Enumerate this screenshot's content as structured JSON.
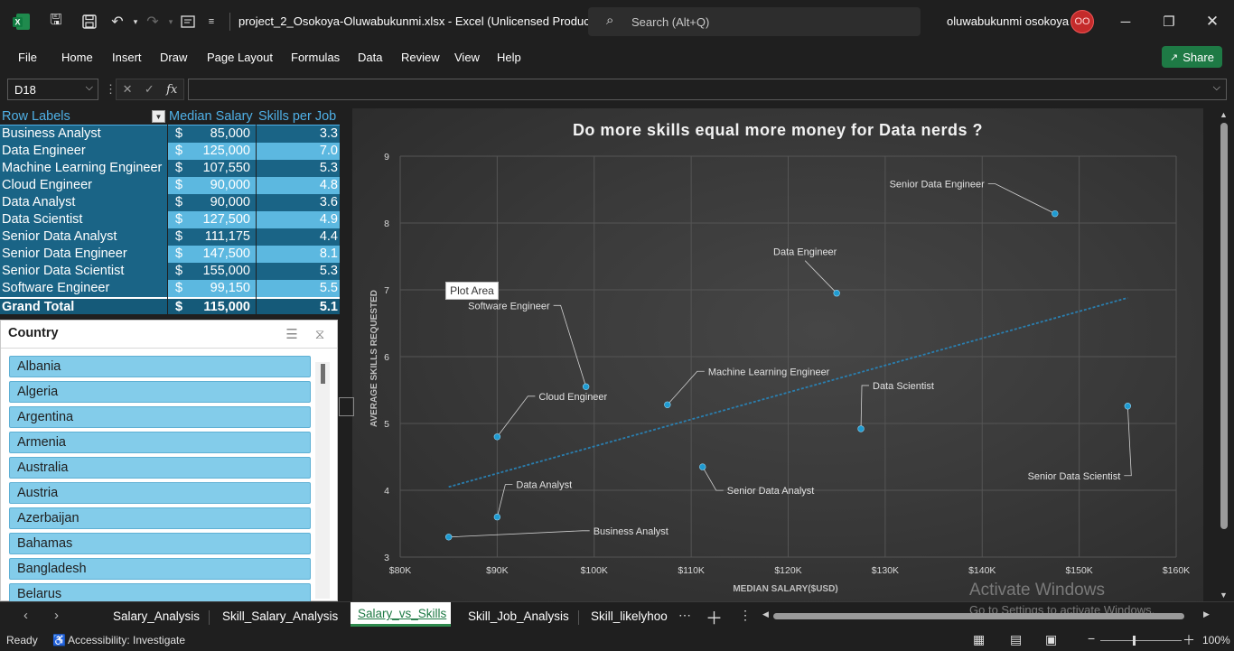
{
  "titlebar": {
    "doc_title": "project_2_Osokoya-Oluwabukunmi.xlsx  -  Excel (Unlicensed Product)",
    "search_placeholder": "Search (Alt+Q)",
    "user_name": "oluwabukunmi osokoya",
    "avatar_initials": "OO"
  },
  "menu": {
    "items": [
      "File",
      "Home",
      "Insert",
      "Draw",
      "Page Layout",
      "Formulas",
      "Data",
      "Review",
      "View",
      "Help"
    ],
    "share_label": "Share"
  },
  "formula_bar": {
    "name_box": "D18",
    "fx_label": "fx",
    "formula": ""
  },
  "pivot": {
    "headers": [
      "Row Labels",
      "Median Salary",
      "Skills per Job"
    ],
    "rows": [
      {
        "label": "Business Analyst",
        "salary": "85,000",
        "skills": "3.3"
      },
      {
        "label": "Data Engineer",
        "salary": "125,000",
        "skills": "7.0"
      },
      {
        "label": "Machine Learning Engineer",
        "salary": "107,550",
        "skills": "5.3"
      },
      {
        "label": "Cloud Engineer",
        "salary": "90,000",
        "skills": "4.8"
      },
      {
        "label": "Data Analyst",
        "salary": "90,000",
        "skills": "3.6"
      },
      {
        "label": "Data Scientist",
        "salary": "127,500",
        "skills": "4.9"
      },
      {
        "label": "Senior Data Analyst",
        "salary": "111,175",
        "skills": "4.4"
      },
      {
        "label": "Senior Data Engineer",
        "salary": "147,500",
        "skills": "8.1"
      },
      {
        "label": "Senior Data Scientist",
        "salary": "155,000",
        "skills": "5.3"
      },
      {
        "label": "Software Engineer",
        "salary": "99,150",
        "skills": "5.5"
      }
    ],
    "grand_total": {
      "label": "Grand Total",
      "salary": "115,000",
      "skills": "5.1"
    },
    "currency": "$"
  },
  "slicer": {
    "title": "Country",
    "items": [
      "Albania",
      "Algeria",
      "Argentina",
      "Armenia",
      "Australia",
      "Austria",
      "Azerbaijan",
      "Bahamas",
      "Bangladesh",
      "Belarus"
    ]
  },
  "chart_data": {
    "type": "scatter",
    "title": "Do more skills equal more money for Data nerds ?",
    "xlabel": "MEDIAN SALARY($USD)",
    "ylabel": "AVERAGE SKILLS REQUESTED",
    "xlim": [
      80000,
      160000
    ],
    "ylim": [
      3,
      9
    ],
    "x_ticks": [
      "$80K",
      "$90K",
      "$100K",
      "$110K",
      "$120K",
      "$130K",
      "$140K",
      "$150K",
      "$160K"
    ],
    "y_ticks": [
      "3",
      "4",
      "5",
      "6",
      "7",
      "8",
      "9"
    ],
    "grid": true,
    "points": [
      {
        "label": "Business Analyst",
        "x": 85000,
        "y": 3.3
      },
      {
        "label": "Data Engineer",
        "x": 125000,
        "y": 6.95
      },
      {
        "label": "Machine Learning Engineer",
        "x": 107550,
        "y": 5.28
      },
      {
        "label": "Cloud Engineer",
        "x": 90000,
        "y": 4.8
      },
      {
        "label": "Data Analyst",
        "x": 90000,
        "y": 3.6
      },
      {
        "label": "Data Scientist",
        "x": 127500,
        "y": 4.92
      },
      {
        "label": "Senior Data Analyst",
        "x": 111175,
        "y": 4.35
      },
      {
        "label": "Senior Data Engineer",
        "x": 147500,
        "y": 8.14
      },
      {
        "label": "Senior Data Scientist",
        "x": 155000,
        "y": 5.26
      },
      {
        "label": "Software Engineer",
        "x": 99150,
        "y": 5.55
      }
    ],
    "trendline": {
      "x": [
        85000,
        155000
      ],
      "y": [
        4.05,
        6.88
      ]
    },
    "point_color": "#1f9bd1",
    "trend_color": "#2a7fb0",
    "tooltip": "Plot Area"
  },
  "tabs": {
    "items": [
      "Salary_Analysis",
      "Skill_Salary_Analysis",
      "Salary_vs_Skills",
      "Skill_Job_Analysis",
      "Skill_likelyhoo"
    ],
    "active": "Salary_vs_Skills"
  },
  "watermark": {
    "line1": "Activate Windows",
    "line2": "Go to Settings to activate Windows."
  },
  "statusbar": {
    "ready": "Ready",
    "accessibility": "Accessibility: Investigate",
    "zoom": "100%"
  }
}
